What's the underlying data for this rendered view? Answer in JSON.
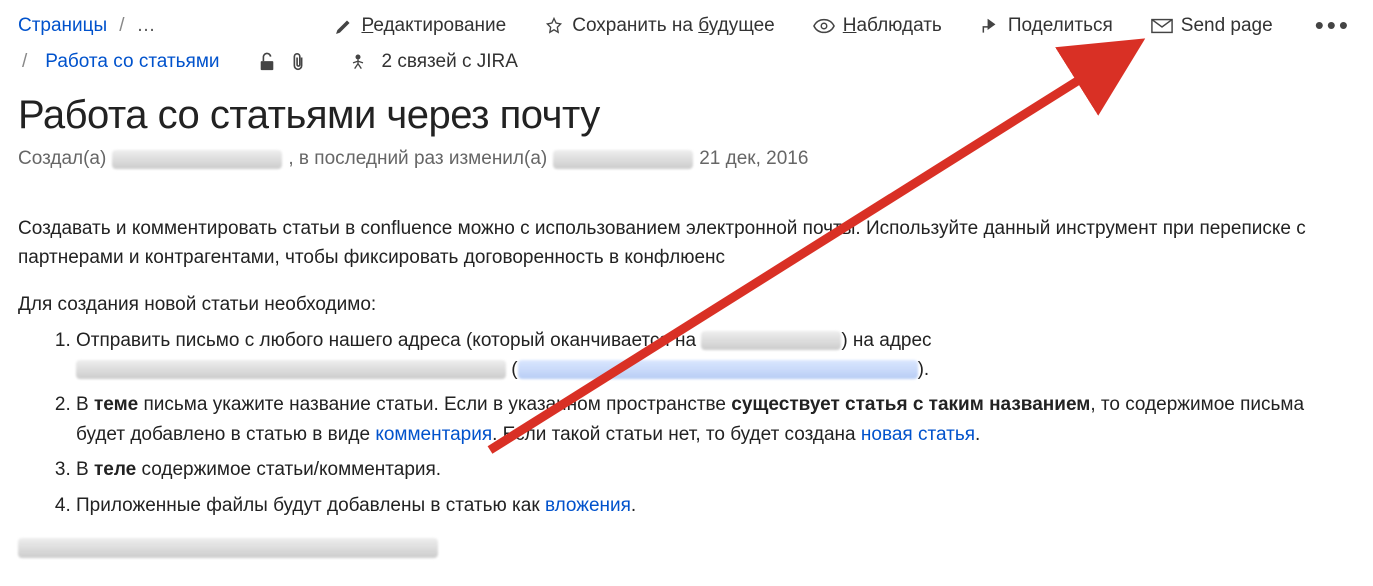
{
  "breadcrumbs": {
    "pages": "Страницы",
    "ellipsis": "…",
    "current": "Работа со статьями"
  },
  "toolbar": {
    "edit": {
      "pre": "",
      "hot": "Р",
      "post": "едактирование"
    },
    "save": {
      "pre": "Сохранить на ",
      "hot": "б",
      "post": "удущее"
    },
    "watch": {
      "pre": "",
      "hot": "Н",
      "post": "аблюдать"
    },
    "share": "Поделиться",
    "send": "Send page"
  },
  "secondrow": {
    "jira": "2 связей с JIRA"
  },
  "page": {
    "title": "Работа со статьями через почту",
    "byline_created": "Создал(а)",
    "byline_modified": ", в последний раз изменил(а)",
    "byline_date": "21 дек, 2016"
  },
  "content": {
    "intro": "Создавать и комментировать статьи в confluence можно с использованием электронной почты. Используйте данный инструмент при переписке с партнерами и контрагентами, чтобы фиксировать договоренность в конфлюенс",
    "pre_list": "Для создания новой статьи необходимо:",
    "li1_a": "Отправить письмо с любого нашего адреса (который оканчивается на",
    "li1_b": ") на адрес",
    "li1_c": "(",
    "li1_d": ").",
    "li2_a": "В ",
    "li2_bold1": "теме",
    "li2_b": " письма укажите название статьи. Если в указанном пространстве ",
    "li2_bold2": "существует статья с таким названием",
    "li2_c": ", то содержимое письма будет добавлено в статью в виде ",
    "li2_link1": "комментария",
    "li2_d": ". Если такой статьи нет, то будет создана ",
    "li2_link2": "новая статья",
    "li2_e": ".",
    "li3_a": "В ",
    "li3_bold": "теле",
    "li3_b": " содержимое статьи/комментария.",
    "li4_a": "Приложенные файлы будут добавлены в статью как ",
    "li4_link": "вложения",
    "li4_b": "."
  }
}
